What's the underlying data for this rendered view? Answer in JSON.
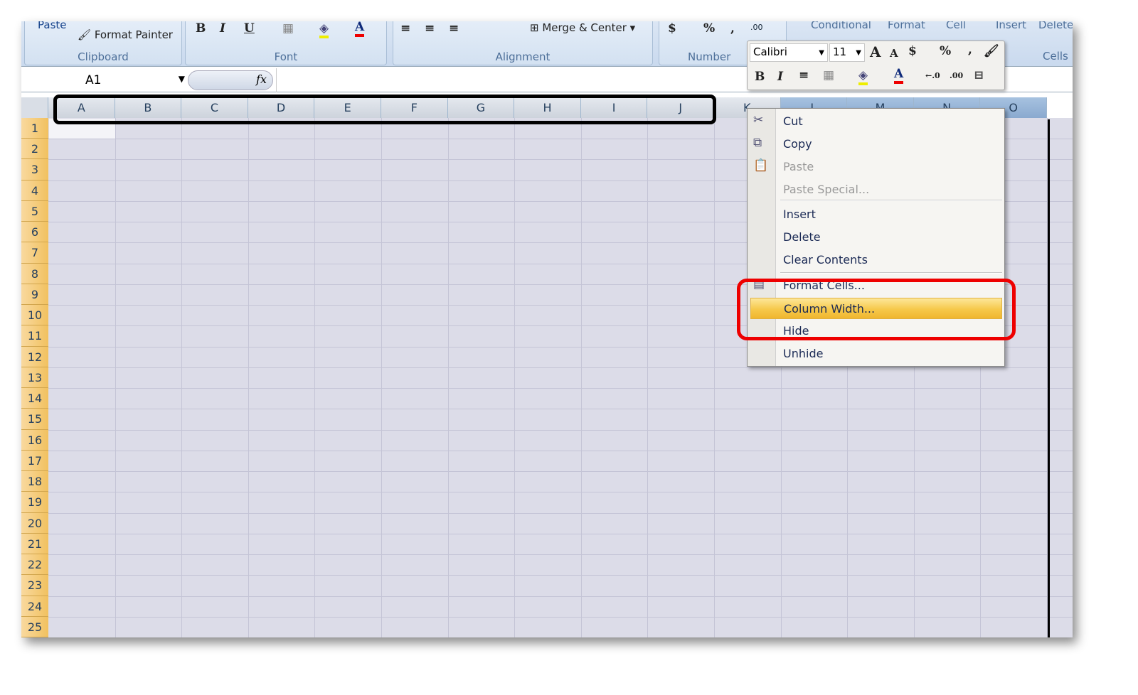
{
  "ribbon": {
    "clipboard": {
      "paste": "Paste",
      "format_painter": "Format Painter",
      "label": "Clipboard"
    },
    "font": {
      "label": "Font",
      "bold": "B",
      "italic": "I",
      "underline": "U"
    },
    "alignment": {
      "merge_center": "Merge & Center",
      "label": "Alignment"
    },
    "number": {
      "currency": "$",
      "percent": "%",
      "comma": ",",
      "inc_dec": ".00",
      "label": "Number"
    },
    "styles": {
      "conditional": "Conditional",
      "format_as": "Format",
      "cell_styles": "Cell"
    },
    "cells": {
      "insert": "Insert",
      "delete": "Delete",
      "label": "Cells"
    }
  },
  "formula_bar": {
    "name_box": "A1",
    "fx": "fx",
    "value": ""
  },
  "columns": [
    "A",
    "B",
    "C",
    "D",
    "E",
    "F",
    "G",
    "H",
    "I",
    "J",
    "K",
    "L",
    "M",
    "N",
    "O"
  ],
  "selected_columns": [
    "L",
    "M",
    "N",
    "O"
  ],
  "rows": [
    "1",
    "2",
    "3",
    "4",
    "5",
    "6",
    "7",
    "8",
    "9",
    "10",
    "11",
    "12",
    "13",
    "14",
    "15",
    "16",
    "17",
    "18",
    "19",
    "20",
    "21",
    "22",
    "23",
    "24",
    "25"
  ],
  "mini_toolbar": {
    "font": "Calibri",
    "size": "11",
    "grow": "A",
    "shrink": "A",
    "currency": "$",
    "percent": "%",
    "comma": ",",
    "bold": "B",
    "italic": "I",
    "font_color": "A"
  },
  "context_menu": {
    "items": [
      {
        "label": "Cut",
        "icon": "scissors-icon",
        "enabled": true
      },
      {
        "label": "Copy",
        "icon": "copy-icon",
        "enabled": true
      },
      {
        "label": "Paste",
        "icon": "paste-icon",
        "enabled": false
      },
      {
        "label": "Paste Special...",
        "enabled": false
      },
      {
        "label": "Insert",
        "enabled": true
      },
      {
        "label": "Delete",
        "enabled": true
      },
      {
        "label": "Clear Contents",
        "enabled": true
      },
      {
        "label": "Format Cells...",
        "icon": "format-cells-icon",
        "enabled": true
      },
      {
        "label": "Column Width...",
        "enabled": true,
        "highlighted": true
      },
      {
        "label": "Hide",
        "enabled": true
      },
      {
        "label": "Unhide",
        "enabled": true
      }
    ]
  },
  "colors": {
    "highlight_box": "#e00000",
    "annotation_box": "#000000",
    "menu_highlight": "#f6c84a",
    "row_header": "#f1c15f"
  }
}
